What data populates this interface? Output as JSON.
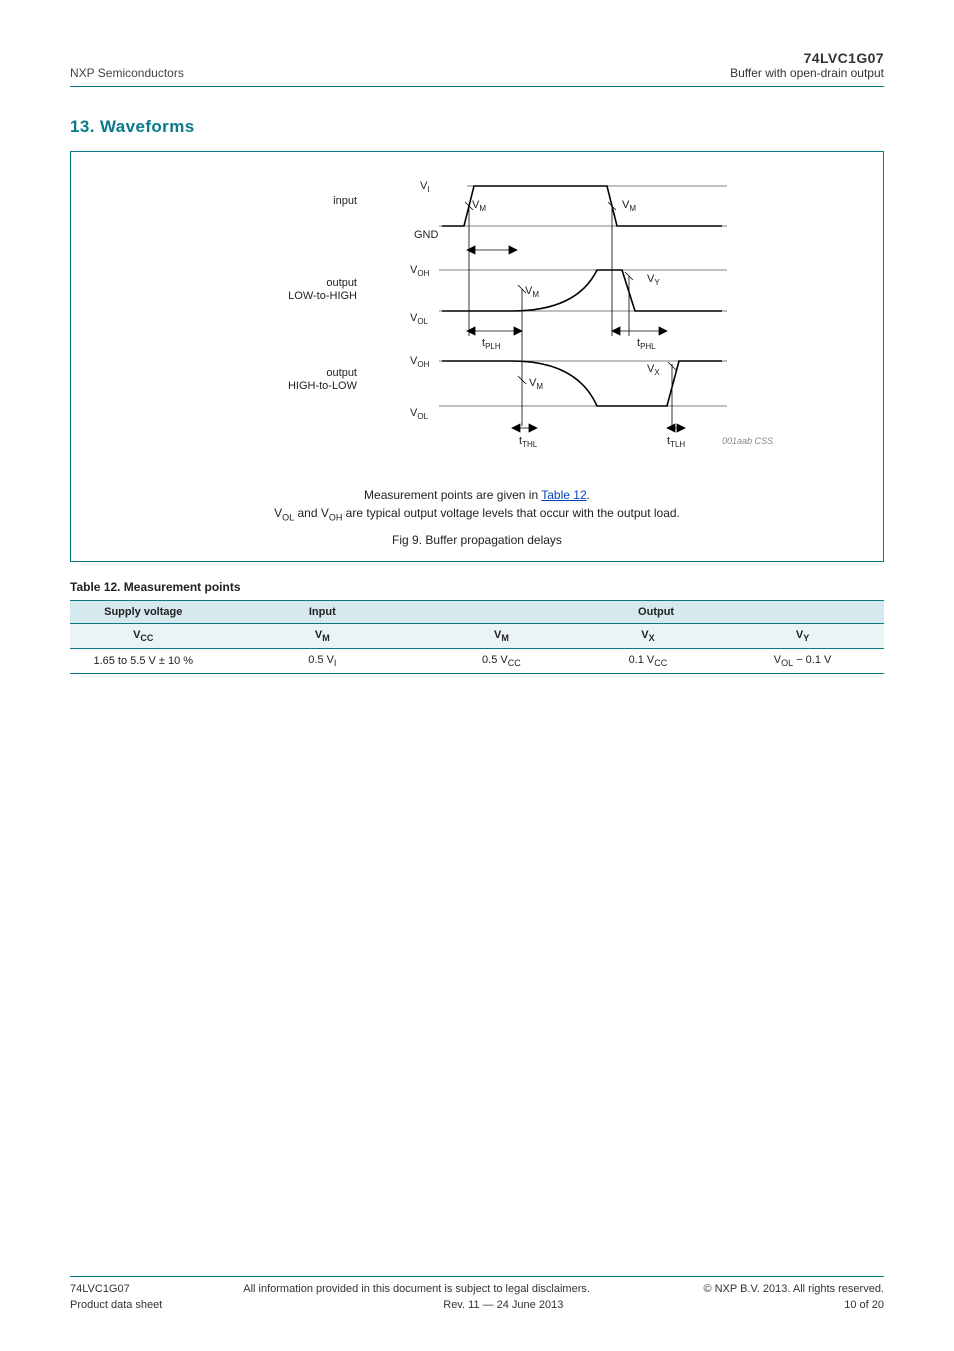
{
  "header": {
    "company": "NXP Semiconductors",
    "product": "74LVC1G07",
    "subtitle": "Buffer with open-drain output"
  },
  "section": {
    "title": "13. Waveforms"
  },
  "figure": {
    "labels": {
      "input": "input",
      "output_low": "output\nLOW-to-HIGH",
      "output_high": "output\nHIGH-to-LOW",
      "VI": "V",
      "VI_sub": "I",
      "VOH": "V",
      "VOH_sub": "OH",
      "VOL": "V",
      "VOL_sub": "OL",
      "VM": "V",
      "VM_sub": "M",
      "GND": "GND",
      "tPLH": "t",
      "tPLH_sub": "PLH",
      "tPHL": "t",
      "tPHL_sub": "PHL",
      "tTLH": "t",
      "tTLH_sub": "TLH",
      "tTHL": "t",
      "tTHL_sub": "THL",
      "ref": "001aab CSS"
    },
    "caption_prefix": "Measurement points are given in ",
    "caption_link": "Table 12",
    "caption_after_link": ".",
    "caption_line2": "V",
    "caption_line2_sub": "OL",
    "caption_line2_rest": " and V",
    "caption_line2_sub2": "OH",
    "caption_line2_rest2": " are typical output voltage levels that occur with the output load.",
    "caption_title": "Fig 9.    Buffer propagation delays"
  },
  "table": {
    "title": "Table 12. Measurement points",
    "head": {
      "supply": "Supply voltage",
      "input": "Input",
      "output": "Output",
      "vcc": "V",
      "vcc_sub": "CC",
      "vm_in": "V",
      "vm_in_sub": "M",
      "vm_out": "V",
      "vm_out_sub": "M",
      "vx": "V",
      "vx_sub": "X",
      "vy": "V",
      "vy_sub": "Y"
    },
    "row": {
      "supply_note": "1.65 to 5.5 V ± 10 %",
      "vm_in": "0.5 V",
      "vm_in_sub": "I",
      "vm_out": "0.5 V",
      "vm_out_sub": "CC",
      "vx": "0.1 V",
      "vx_sub": "CC",
      "vy": "V",
      "vy_sub": "OL",
      "vy_rest": " − 0.1 V"
    }
  },
  "footer": {
    "doc_id": "74LVC1G07",
    "product_ds": "Product data sheet",
    "legal": "All information provided in this document is subject to legal disclaimers.",
    "copyright": "© NXP B.V. 2013. All rights reserved.",
    "rev": "Rev. 11 — 24 June 2013",
    "page": "10 of 20"
  }
}
